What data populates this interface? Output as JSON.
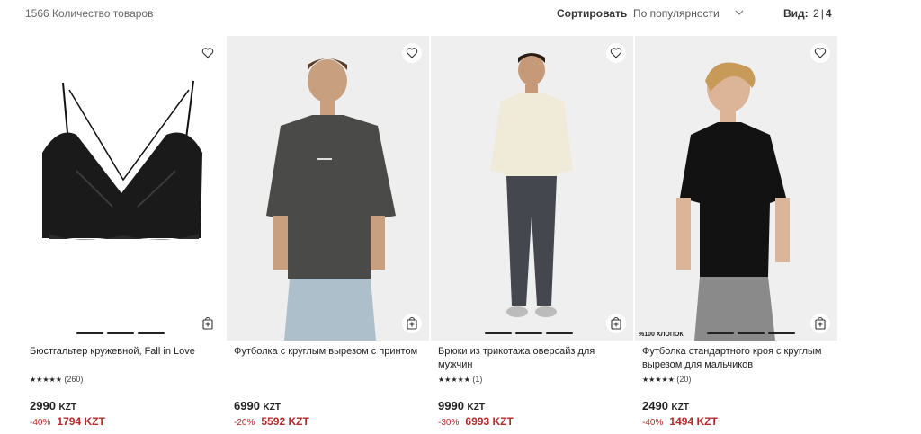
{
  "header": {
    "count_text": "1566 Количество товаров",
    "sort_label": "Сортировать",
    "sort_value": "По популярности",
    "view_label": "Вид:",
    "view_options": [
      "2",
      "4"
    ],
    "view_separator": "|"
  },
  "products": [
    {
      "name": "Бюстгальтер кружевной, Fall in Love",
      "stars": "★★★★★",
      "reviews": "(260)",
      "price": "2990",
      "currency": "KZT",
      "discount": "-40%",
      "sale_price": "1794 KZT",
      "badge": "",
      "icon": "lace-bra-image"
    },
    {
      "name": "Футболка с круглым вырезом с принтом",
      "stars": "",
      "reviews": "",
      "price": "6990",
      "currency": "KZT",
      "discount": "-20%",
      "sale_price": "5592 KZT",
      "badge": "",
      "icon": "grey-tshirt-model-image"
    },
    {
      "name": "Брюки из трикотажа оверсайз для мужчин",
      "stars": "★★★★★",
      "reviews": "(1)",
      "price": "9990",
      "currency": "KZT",
      "discount": "-30%",
      "sale_price": "6993 KZT",
      "badge": "",
      "icon": "knit-pants-model-image"
    },
    {
      "name": "Футболка стандартного кроя с круглым вырезом для мальчиков",
      "stars": "★★★★★",
      "reviews": "(20)",
      "price": "2490",
      "currency": "KZT",
      "discount": "-40%",
      "sale_price": "1494 KZT",
      "badge": "%100 ХЛОПОК",
      "icon": "black-tshirt-boy-image"
    }
  ],
  "colors": {
    "sale": "#b22a2a",
    "text": "#222222",
    "muted": "#666666",
    "image_bg": "#f2f2f2"
  },
  "icons": {
    "favorite": "heart-icon",
    "cart": "add-to-cart-icon",
    "sort": "chevron-down-icon"
  }
}
